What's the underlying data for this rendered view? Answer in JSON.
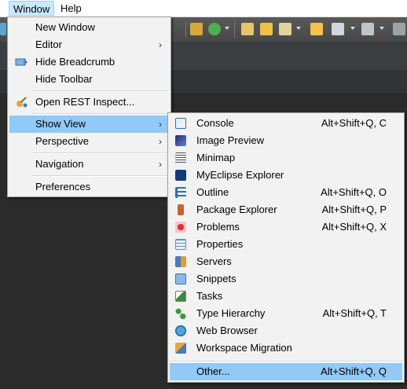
{
  "menubar": {
    "window": "Window",
    "help": "Help"
  },
  "window_menu": {
    "new_window": "New Window",
    "editor": "Editor",
    "hide_breadcrumb": "Hide Breadcrumb",
    "hide_toolbar": "Hide Toolbar",
    "open_rest": "Open REST Inspect...",
    "show_view": "Show View",
    "perspective": "Perspective",
    "navigation": "Navigation",
    "preferences": "Preferences"
  },
  "show_view_menu": {
    "items": [
      {
        "label": "Console",
        "shortcut": "Alt+Shift+Q, C",
        "icon": "console-icon"
      },
      {
        "label": "Image Preview",
        "shortcut": "",
        "icon": "image-preview-icon"
      },
      {
        "label": "Minimap",
        "shortcut": "",
        "icon": "minimap-icon"
      },
      {
        "label": "MyEclipse Explorer",
        "shortcut": "",
        "icon": "myeclipse-icon"
      },
      {
        "label": "Outline",
        "shortcut": "Alt+Shift+Q, O",
        "icon": "outline-icon"
      },
      {
        "label": "Package Explorer",
        "shortcut": "Alt+Shift+Q, P",
        "icon": "package-explorer-icon"
      },
      {
        "label": "Problems",
        "shortcut": "Alt+Shift+Q, X",
        "icon": "problems-icon"
      },
      {
        "label": "Properties",
        "shortcut": "",
        "icon": "properties-icon"
      },
      {
        "label": "Servers",
        "shortcut": "",
        "icon": "servers-icon"
      },
      {
        "label": "Snippets",
        "shortcut": "",
        "icon": "snippets-icon"
      },
      {
        "label": "Tasks",
        "shortcut": "",
        "icon": "tasks-icon"
      },
      {
        "label": "Type Hierarchy",
        "shortcut": "Alt+Shift+Q, T",
        "icon": "type-hierarchy-icon"
      },
      {
        "label": "Web Browser",
        "shortcut": "",
        "icon": "web-browser-icon"
      },
      {
        "label": "Workspace Migration",
        "shortcut": "",
        "icon": "workspace-migration-icon"
      }
    ],
    "other": {
      "label": "Other...",
      "shortcut": "Alt+Shift+Q, Q"
    }
  },
  "colors": {
    "highlight": "#91c9f7",
    "menu_bg": "#f2f2f2",
    "toolbar_bg": "#4d4d4d"
  }
}
